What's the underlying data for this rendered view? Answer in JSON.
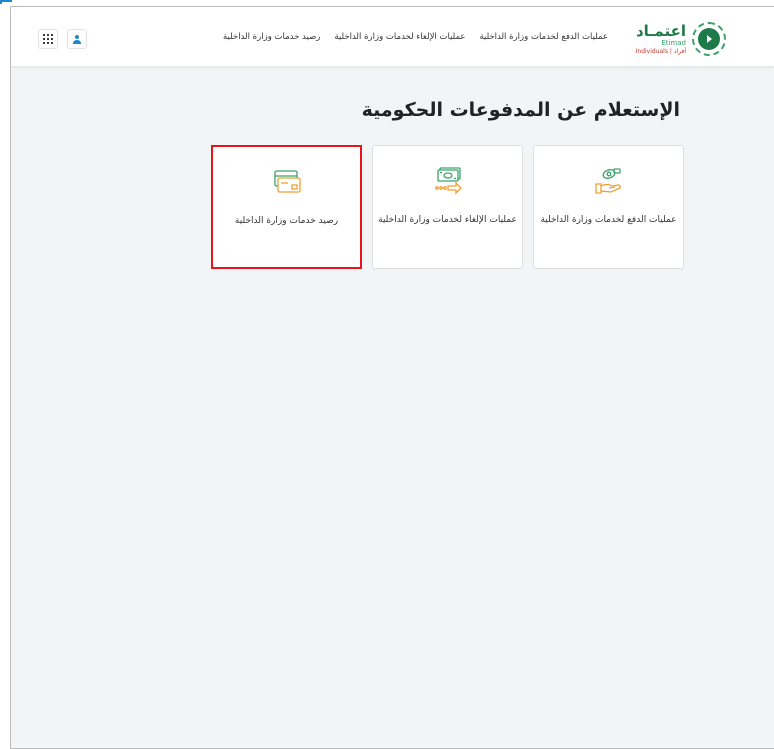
{
  "header": {
    "logo": {
      "arabic": "اعتمـاد",
      "english": "Etimad",
      "sub": "Individuals | أفراد"
    },
    "nav": [
      "عمليات الدفع لخدمات وزارة الداخلية",
      "عمليات الإلغاء لخدمات وزارة الداخلية",
      "رصيد خدمات وزارة الداخلية"
    ],
    "user_icon": "user-icon",
    "apps_icon": "apps-grid-icon"
  },
  "main": {
    "title": "الإستعلام عن المدفوعات الحكومية",
    "cards": [
      {
        "label": "عمليات الدفع لخدمات وزارة الداخلية",
        "icon": "hand-money-icon",
        "selected": false
      },
      {
        "label": "عمليات الإلغاء لخدمات وزارة الداخلية",
        "icon": "cash-refund-icon",
        "selected": false
      },
      {
        "label": "رصيد خدمات وزارة الداخلية",
        "icon": "card-balance-icon",
        "selected": true
      }
    ]
  },
  "colors": {
    "brand_green": "#1f7a4a",
    "icon_green": "#3aa36a",
    "icon_orange": "#f0a030",
    "highlight_red": "#e8161b",
    "user_blue": "#1e88c8"
  }
}
